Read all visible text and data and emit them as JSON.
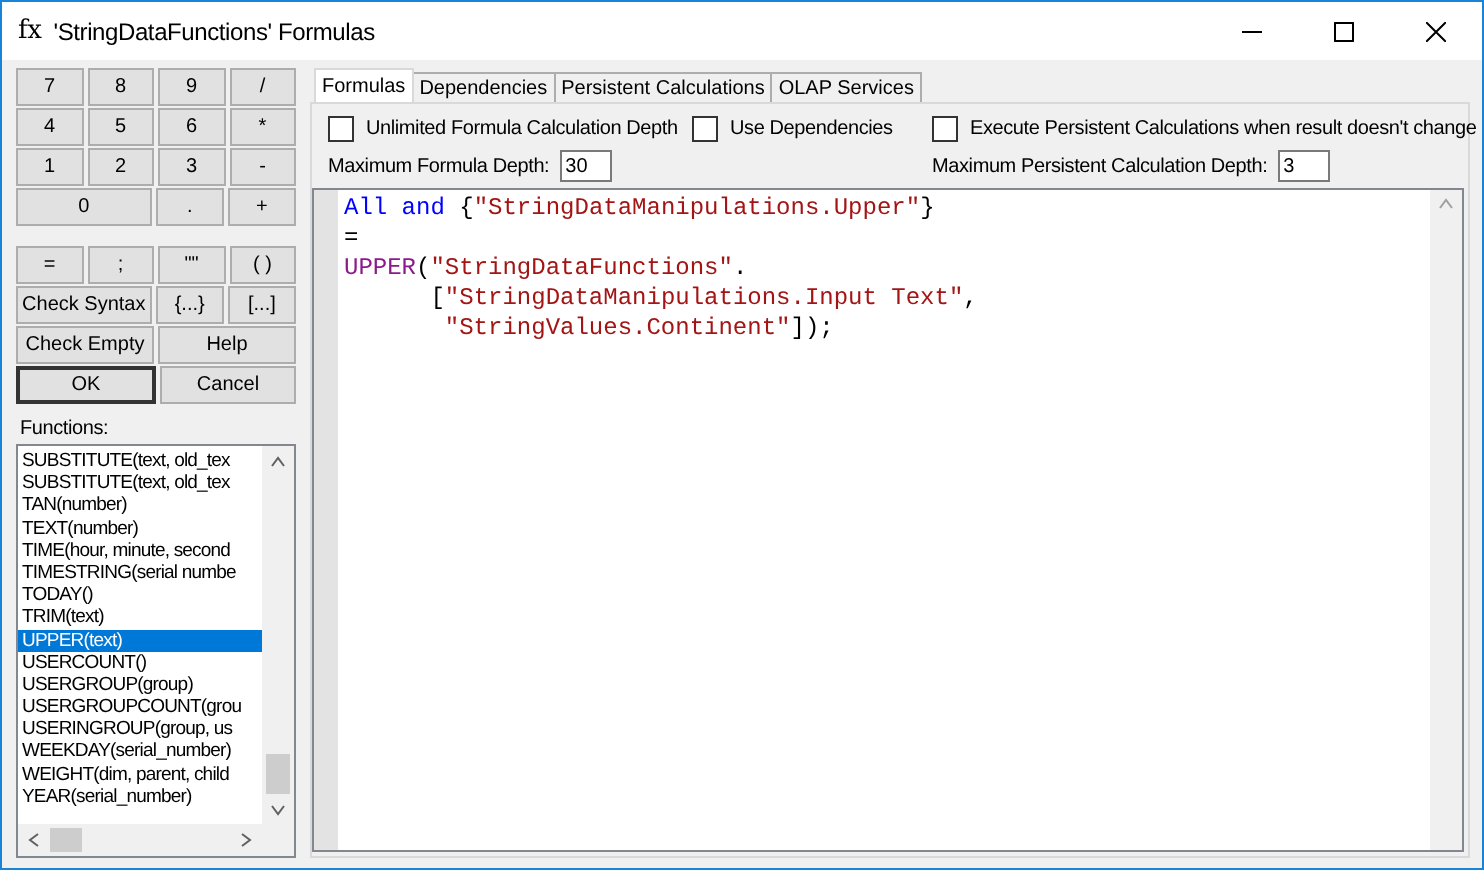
{
  "window": {
    "title": "'StringDataFunctions' Formulas",
    "icon": "fx"
  },
  "keypad": [
    [
      "7",
      "8",
      "9",
      "/"
    ],
    [
      "4",
      "5",
      "6",
      "*"
    ],
    [
      "1",
      "2",
      "3",
      "-"
    ],
    [
      "0",
      ".",
      "+"
    ]
  ],
  "operators": [
    [
      "=",
      ";",
      "\"\"",
      "( )"
    ],
    [
      "Check Syntax",
      "{...}",
      "[...]"
    ],
    [
      "Check Empty",
      "Help"
    ],
    [
      "OK",
      "Cancel"
    ]
  ],
  "functions": {
    "label": "Functions:",
    "items": [
      {
        "text": "SUBSTITUTE(text, old_tex",
        "selected": false
      },
      {
        "text": "SUBSTITUTE(text, old_tex",
        "selected": false
      },
      {
        "text": "TAN(number)",
        "selected": false
      },
      {
        "text": "TEXT(number)",
        "selected": false
      },
      {
        "text": "TIME(hour, minute, second",
        "selected": false
      },
      {
        "text": "TIMESTRING(serial numbe",
        "selected": false
      },
      {
        "text": "TODAY()",
        "selected": false
      },
      {
        "text": "TRIM(text)",
        "selected": false
      },
      {
        "text": "UPPER(text)",
        "selected": true
      },
      {
        "text": "USERCOUNT()",
        "selected": false
      },
      {
        "text": "USERGROUP(group)",
        "selected": false
      },
      {
        "text": "USERGROUPCOUNT(grou",
        "selected": false
      },
      {
        "text": "USERINGROUP(group, us",
        "selected": false
      },
      {
        "text": "WEEKDAY(serial_number)",
        "selected": false
      },
      {
        "text": "WEIGHT(dim, parent, child",
        "selected": false
      },
      {
        "text": "YEAR(serial_number)",
        "selected": false
      }
    ]
  },
  "tabs": [
    {
      "label": "Formulas",
      "selected": true
    },
    {
      "label": "Dependencies",
      "selected": false
    },
    {
      "label": "Persistent Calculations",
      "selected": false
    },
    {
      "label": "OLAP Services",
      "selected": false
    }
  ],
  "options": [
    {
      "label": "Unlimited Formula Calculation Depth",
      "checked": false
    },
    {
      "label": "Use Dependencies",
      "checked": false
    },
    {
      "label": "Execute Persistent Calculations when result doesn't change",
      "checked": false
    }
  ],
  "depth_fields": [
    {
      "label": "Maximum Formula Depth:",
      "value": "30"
    },
    {
      "label": "Maximum Persistent Calculation Depth:",
      "value": "3"
    }
  ],
  "editor": {
    "lines": [
      [
        {
          "kind": "keyword",
          "text": "All"
        },
        {
          "kind": "keyword",
          "text": " and"
        },
        {
          "kind": "plain",
          "text": " {"
        },
        {
          "kind": "string",
          "text": "\"StringDataManipulations.Upper\""
        },
        {
          "kind": "plain",
          "text": "}"
        }
      ],
      [
        {
          "kind": "plain",
          "text": "="
        }
      ],
      [
        {
          "kind": "function",
          "text": "UPPER"
        },
        {
          "kind": "plain",
          "text": "("
        },
        {
          "kind": "string",
          "text": "\"StringDataFunctions\""
        },
        {
          "kind": "plain",
          "text": "."
        }
      ],
      [
        {
          "kind": "plain",
          "text": "      ["
        },
        {
          "kind": "string",
          "text": "\"StringDataManipulations.Input Text\""
        },
        {
          "kind": "plain",
          "text": ","
        }
      ],
      [
        {
          "kind": "string",
          "text": "       \"StringValues.Continent\""
        },
        {
          "kind": "plain",
          "text": "]);"
        }
      ]
    ]
  }
}
